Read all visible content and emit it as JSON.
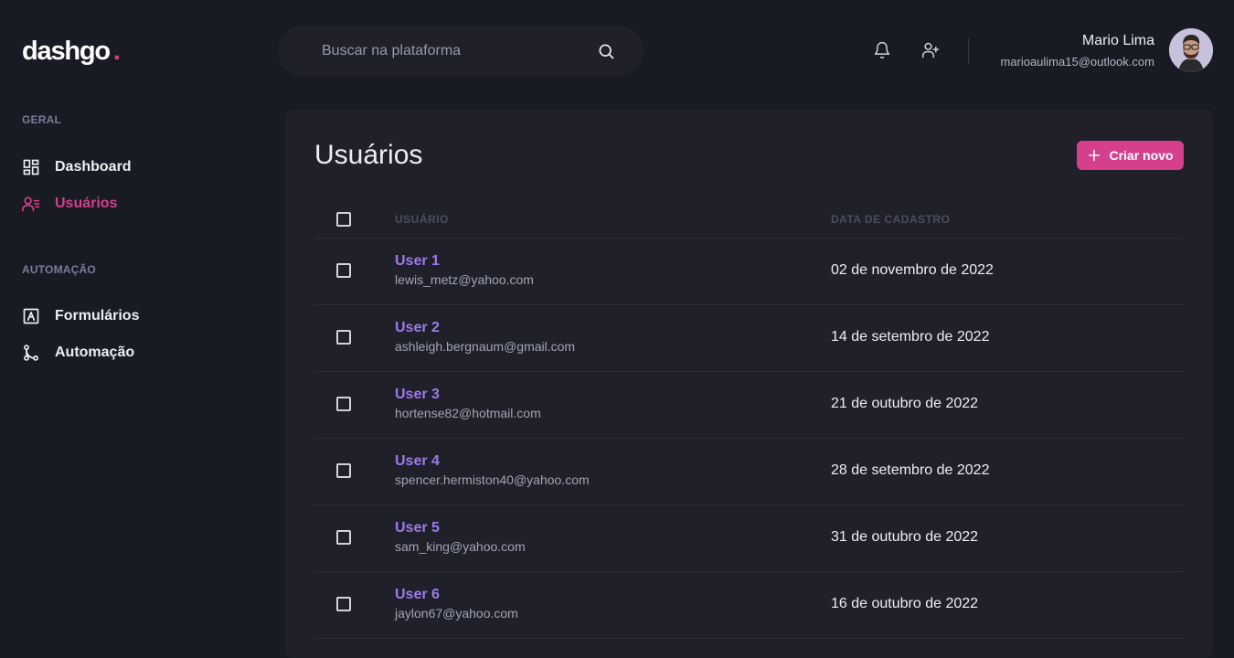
{
  "brand": {
    "name": "dashgo",
    "dot": ".",
    "accent_color": "#d53f8c"
  },
  "search": {
    "placeholder": "Buscar na plataforma",
    "icon": "search-icon"
  },
  "header_actions": [
    {
      "icon": "bell-icon"
    },
    {
      "icon": "user-add-icon"
    }
  ],
  "profile": {
    "name": "Mario Lima",
    "email": "marioaulima15@outlook.com"
  },
  "sidebar": {
    "sections": [
      {
        "title": "GERAL",
        "items": [
          {
            "label": "Dashboard",
            "icon": "dashboard-icon",
            "active": false
          },
          {
            "label": "Usuários",
            "icon": "users-icon",
            "active": true
          }
        ]
      },
      {
        "title": "AUTOMAÇÃO",
        "items": [
          {
            "label": "Formulários",
            "icon": "form-icon",
            "active": false
          },
          {
            "label": "Automação",
            "icon": "git-merge-icon",
            "active": false
          }
        ]
      }
    ]
  },
  "main": {
    "title": "Usuários",
    "create_button": {
      "label": "Criar novo",
      "icon": "plus-icon"
    },
    "table": {
      "columns": [
        "USUÁRIO",
        "DATA DE CADASTRO"
      ],
      "rows": [
        {
          "name": "User 1",
          "email": "lewis_metz@yahoo.com",
          "date": "02 de novembro de 2022"
        },
        {
          "name": "User 2",
          "email": "ashleigh.bergnaum@gmail.com",
          "date": "14 de setembro de 2022"
        },
        {
          "name": "User 3",
          "email": "hortense82@hotmail.com",
          "date": "21 de outubro de 2022"
        },
        {
          "name": "User 4",
          "email": "spencer.hermiston40@yahoo.com",
          "date": "28 de setembro de 2022"
        },
        {
          "name": "User 5",
          "email": "sam_king@yahoo.com",
          "date": "31 de outubro de 2022"
        },
        {
          "name": "User 6",
          "email": "jaylon67@yahoo.com",
          "date": "16 de outubro de 2022"
        }
      ]
    }
  },
  "colors": {
    "background": "#181b23",
    "panel": "#1f2029",
    "accent": "#d53f8c",
    "user_link": "#9f7aea"
  }
}
